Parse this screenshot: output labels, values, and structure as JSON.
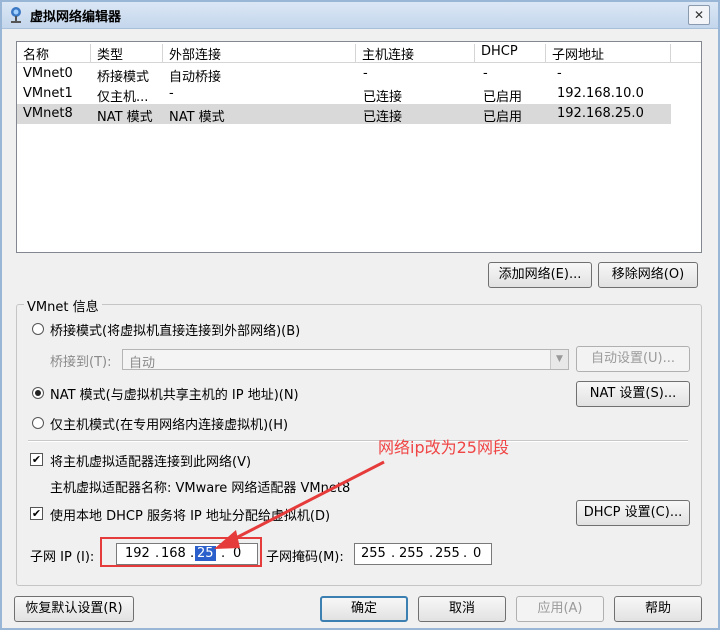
{
  "window": {
    "title": "虚拟网络编辑器",
    "close_glyph": "✕"
  },
  "table": {
    "headers": [
      "名称",
      "类型",
      "外部连接",
      "主机连接",
      "DHCP",
      "子网地址"
    ],
    "rows": [
      [
        "VMnet0",
        "桥接模式",
        "自动桥接",
        "-",
        "-",
        "-"
      ],
      [
        "VMnet1",
        "仅主机...",
        "-",
        "已连接",
        "已启用",
        "192.168.10.0"
      ],
      [
        "VMnet8",
        "NAT 模式",
        "NAT 模式",
        "已连接",
        "已启用",
        "192.168.25.0"
      ]
    ],
    "selected_row": 2
  },
  "buttons": {
    "add_network": "添加网络(E)...",
    "remove_network": "移除网络(O)",
    "auto_settings": "自动设置(U)...",
    "nat_settings": "NAT 设置(S)...",
    "dhcp_settings": "DHCP 设置(C)...",
    "restore_defaults": "恢复默认设置(R)",
    "ok": "确定",
    "cancel": "取消",
    "apply": "应用(A)",
    "help": "帮助"
  },
  "vmnet_info": {
    "legend": "VMnet 信息",
    "bridged_radio": "桥接模式(将虚拟机直接连接到外部网络)(B)",
    "bridged_to_label": "桥接到(T):",
    "bridged_to_value": "自动",
    "nat_radio": "NAT 模式(与虚拟机共享主机的 IP 地址)(N)",
    "hostonly_radio": "仅主机模式(在专用网络内连接虚拟机)(H)",
    "selected_mode": "nat",
    "connect_adapter_check": "将主机虚拟适配器连接到此网络(V)",
    "connect_adapter_checked": true,
    "adapter_name_label": "主机虚拟适配器名称: VMware 网络适配器 VMnet8",
    "use_dhcp_check": "使用本地 DHCP 服务将 IP 地址分配给虚拟机(D)",
    "use_dhcp_checked": true,
    "subnet_ip_label": "子网 IP (I):",
    "subnet_ip": [
      "192",
      "168",
      "25",
      "0"
    ],
    "subnet_mask_label": "子网掩码(M):",
    "subnet_mask": [
      "255",
      "255",
      "255",
      "0"
    ]
  },
  "annotation": {
    "text": "网络ip改为25网段",
    "color": "#f04545"
  },
  "icons": {
    "app": "network-editor-icon",
    "dropdown": "chevron-down-icon",
    "check": "checkmark-icon"
  }
}
